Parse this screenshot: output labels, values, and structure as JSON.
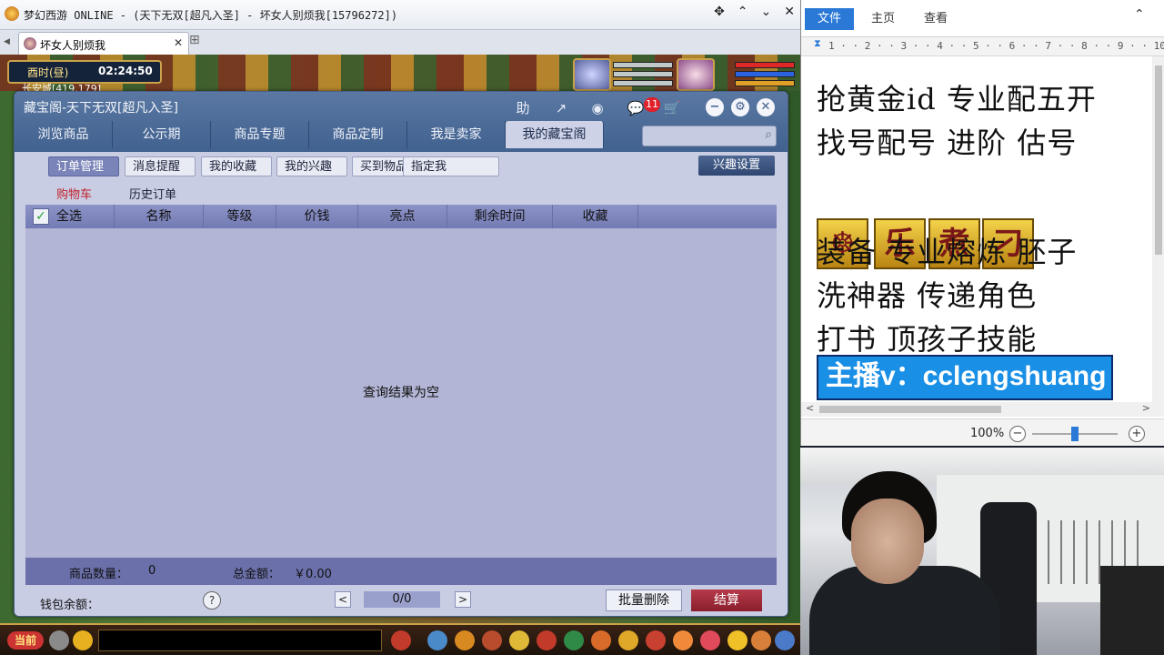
{
  "game_window": {
    "title": "梦幻西游 ONLINE - (天下无双[超凡入圣] - 坏女人别烦我[15796272])",
    "tab_label": "坏女人别烦我",
    "clock_period": "酉时(昼)",
    "clock_time": "02:24:50",
    "location": "长安城[419,179]",
    "current_channel": "当前"
  },
  "dialog": {
    "title": "藏宝阁-天下无双[超凡入圣]",
    "help_label": "助",
    "message_badge": "11",
    "main_tabs": [
      {
        "label": "浏览商品"
      },
      {
        "label": "公示期"
      },
      {
        "label": "商品专题"
      },
      {
        "label": "商品定制"
      },
      {
        "label": "我是卖家"
      },
      {
        "label": "我的藏宝阁"
      }
    ],
    "active_tab": 5,
    "search_placeholder": "",
    "sub_tabs": [
      {
        "label": "订单管理"
      },
      {
        "label": "消息提醒"
      },
      {
        "label": "我的收藏"
      },
      {
        "label": "我的兴趣"
      },
      {
        "label": "买到物品"
      },
      {
        "label": "指定我"
      }
    ],
    "interest_settings": "兴趣设置",
    "chips": {
      "cart": "购物车",
      "history": "历史订单"
    },
    "columns": {
      "select_all": "全选",
      "name": "名称",
      "level": "等级",
      "price": "价钱",
      "highlight": "亮点",
      "remaining_time": "剩余时间",
      "favorites": "收藏"
    },
    "empty_message": "查询结果为空",
    "summary": {
      "count_label": "商品数量：",
      "count_value": "0",
      "total_label": "总金额：",
      "total_value": "￥0.00"
    },
    "footer": {
      "wallet_label": "钱包余额：",
      "help": "?",
      "prev": "<",
      "page": "0/0",
      "next": ">",
      "batch_delete": "批量删除",
      "checkout": "结算"
    }
  },
  "document": {
    "ribbon_tabs": [
      "文件",
      "主页",
      "查看"
    ],
    "ruler": "1 · · 2 · · 3 · · 4 · · 5 · · 6 · · 7 · · 8 · · 9 · · 10",
    "lines": [
      "抢黄金id 专业配五开",
      "找号配号 进阶 估号",
      "装备 专业熔炼 胚子",
      "洗神器 传递角色",
      "打书 顶孩子技能"
    ],
    "tiles": [
      "☸",
      "乐",
      "煮",
      "刁"
    ],
    "host_text": "主播v：cclengshuang",
    "zoom": "100%",
    "zoom_level": 0.5
  },
  "colors": {
    "accent_blue": "#2b79d6",
    "checkout_red": "#8a1e2c",
    "cart_red": "#c0202a"
  }
}
